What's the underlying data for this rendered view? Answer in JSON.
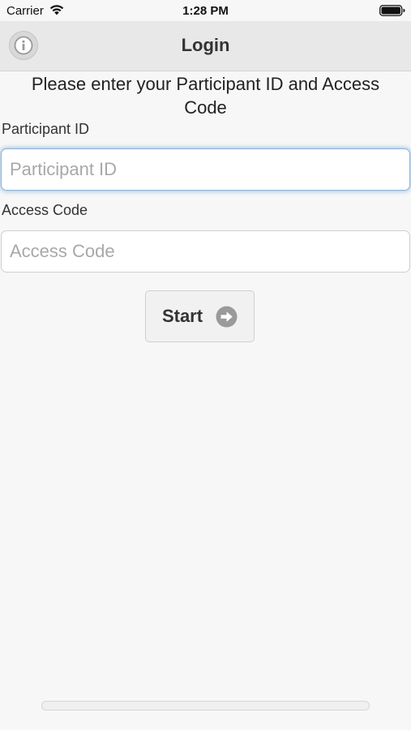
{
  "status_bar": {
    "carrier": "Carrier",
    "time": "1:28 PM",
    "wifi_icon": "wifi-icon",
    "battery_icon": "battery-icon"
  },
  "header": {
    "title": "Login",
    "info_icon": "info-icon"
  },
  "form": {
    "instructions": "Please enter your Participant ID and Access Code",
    "participant_id": {
      "label": "Participant ID",
      "placeholder": "Participant ID",
      "value": ""
    },
    "access_code": {
      "label": "Access Code",
      "placeholder": "Access Code",
      "value": ""
    },
    "start_button": {
      "label": "Start",
      "icon": "arrow-right-circle-icon"
    }
  },
  "colors": {
    "background": "#f7f7f7",
    "header_background": "#e8e8e8",
    "focus_glow": "#5a96d2",
    "icon_gray": "#9a9a9a"
  }
}
